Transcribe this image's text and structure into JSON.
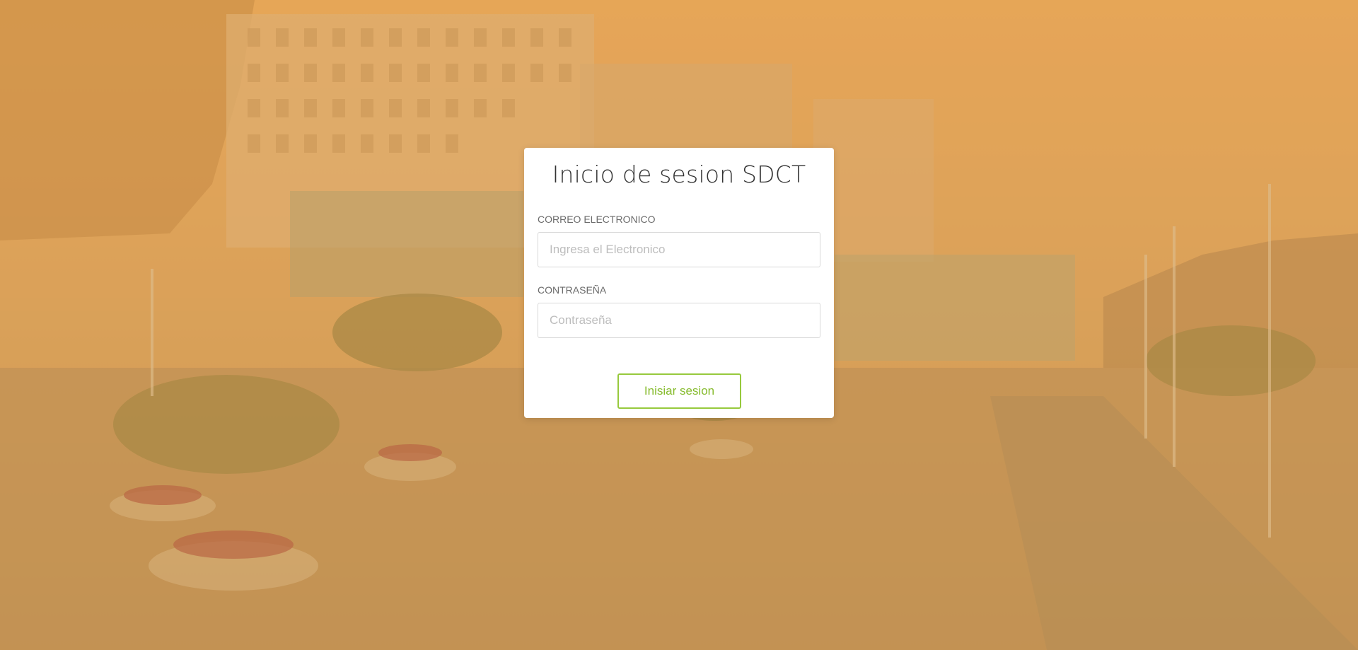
{
  "login": {
    "title": "Inicio de sesion SDCT",
    "email_label": "CORREO ELECTRONICO",
    "email_placeholder": "Ingresa el Electronico",
    "email_value": "",
    "password_label": "CONTRASEÑA",
    "password_placeholder": "Contraseña",
    "password_value": "",
    "submit_label": "Inisiar sesion"
  },
  "colors": {
    "overlay": "#e8a555",
    "accent": "#97c93d",
    "accent_text": "#86bb2d",
    "card": "#ffffff",
    "title": "#333333"
  }
}
